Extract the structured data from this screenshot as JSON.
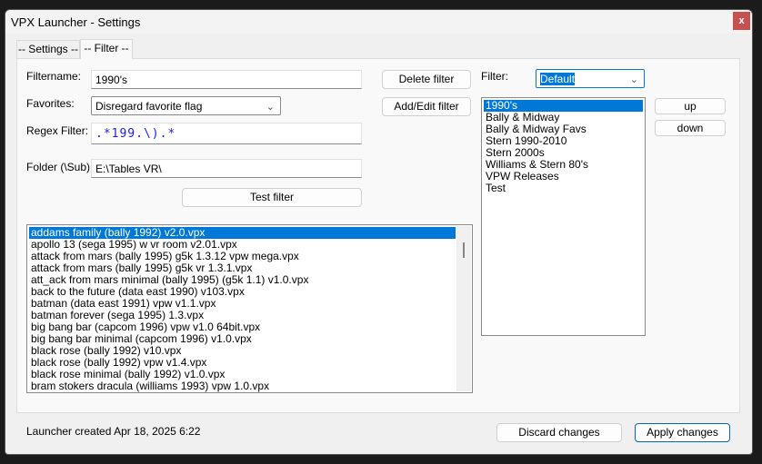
{
  "window": {
    "title": "VPX Launcher - Settings",
    "close_label": "x"
  },
  "tabs": [
    {
      "label": "-- Settings --"
    },
    {
      "label": "-- Filter --"
    }
  ],
  "form": {
    "filtername_label": "Filtername:",
    "filtername_value": "1990's",
    "favorites_label": "Favorites:",
    "favorites_value": "Disregard favorite flag",
    "regex_label": "Regex Filter:",
    "regex_value": ".*199.\\).*",
    "folder_label": "Folder (\\Sub):",
    "folder_value": "E:\\Tables VR\\",
    "test_button": "Test filter",
    "delete_button": "Delete filter",
    "add_edit_button": "Add/Edit filter"
  },
  "filter_select": {
    "label": "Filter:",
    "value": "Default"
  },
  "filter_list": [
    "1990's",
    "Bally & Midway",
    "Bally & Midway Favs",
    "Stern 1990-2010",
    "Stern 2000s",
    "Williams & Stern 80's",
    "VPW Releases",
    "Test"
  ],
  "up_button": "up",
  "down_button": "down",
  "tables": [
    "addams family (bally 1992) v2.0.vpx",
    "apollo 13 (sega 1995) w vr room v2.01.vpx",
    "attack from mars (bally 1995) g5k 1.3.12 vpw mega.vpx",
    "attack from mars (bally 1995) g5k vr 1.3.1.vpx",
    "att_ack from mars minimal (bally 1995) (g5k 1.1) v1.0.vpx",
    "back to the future (data east 1990) v103.vpx",
    "batman (data east 1991) vpw v1.1.vpx",
    "batman forever (sega 1995) 1.3.vpx",
    "big bang bar (capcom 1996) vpw v1.0 64bit.vpx",
    "big bang bar minimal (capcom 1996) v1.0.vpx",
    "black rose (bally 1992) v10.vpx",
    "black rose (bally 1992) vpw v1.4.vpx",
    "black rose minimal (bally 1992) v1.0.vpx",
    "bram stokers dracula (williams 1993) vpw 1.0.vpx"
  ],
  "footer": {
    "status": "Launcher created Apr 18, 2025 6:22",
    "discard_button": "Discard changes",
    "apply_button": "Apply changes"
  }
}
